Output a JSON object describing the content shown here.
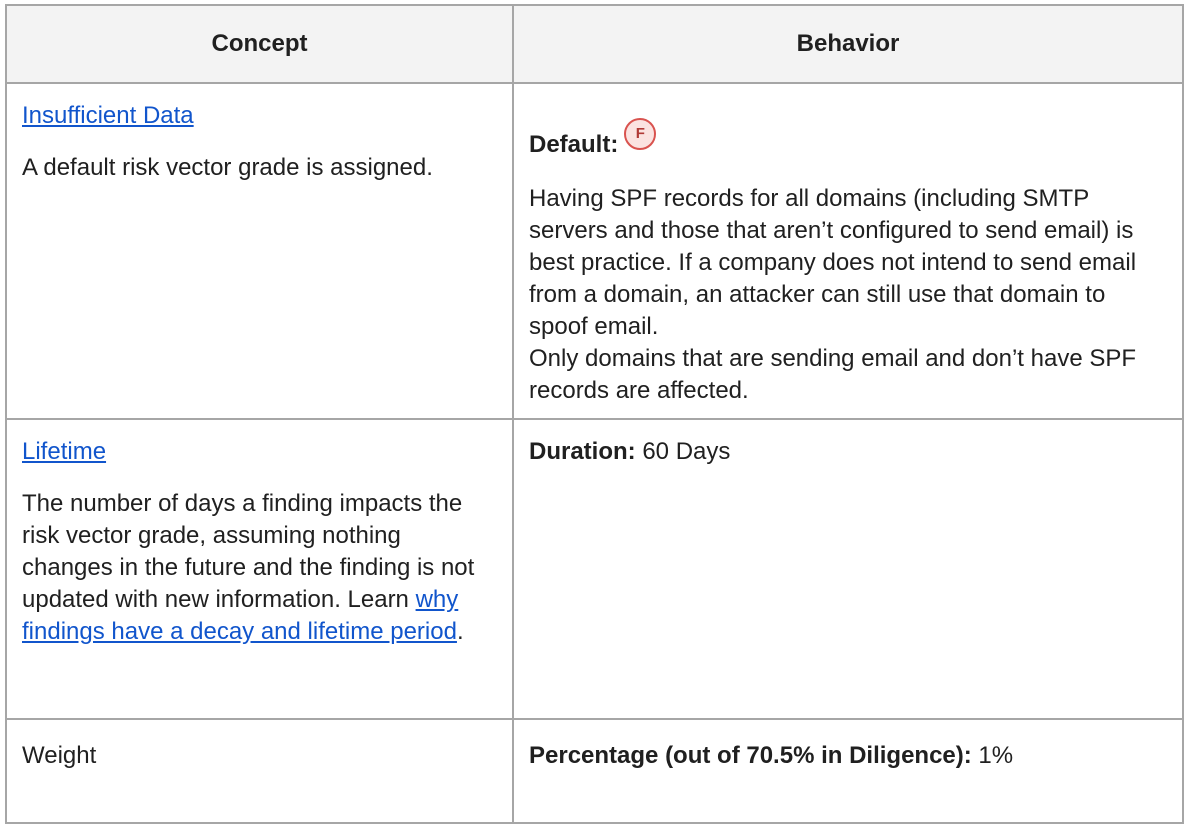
{
  "header": {
    "concept": "Concept",
    "behavior": "Behavior"
  },
  "rows": {
    "insufficient": {
      "concept_link": "Insufficient Data",
      "concept_text": "A default risk vector grade is assigned.",
      "default_label": "Default:",
      "default_grade": "F",
      "description": "Having SPF records for all domains (including SMTP servers and those that aren’t configured to send email) is best practice. If a company does not intend to send email from a domain, an attacker can still use that domain to spoof email.",
      "note": "Only domains that are sending email and don’t have SPF records are affected."
    },
    "lifetime": {
      "concept_link": "Lifetime",
      "concept_text": "The number of days a finding impacts the risk vector grade, assuming nothing changes in the future and the finding is not updated with new information. Learn ",
      "concept_link2": "why findings have a decay and lifetime period",
      "concept_end": ".",
      "duration_label": "Duration:",
      "duration_value": " 60 Days"
    },
    "weight": {
      "concept": "Weight",
      "percentage_label": "Percentage (out of 70.5% in Diligence):",
      "percentage_value": " 1%"
    }
  },
  "colors": {
    "link": "#1155cc",
    "header_bg": "#f3f3f3",
    "border": "#a6a6a6",
    "badge_border": "#d9534f",
    "badge_bg": "#fbe3e1"
  }
}
